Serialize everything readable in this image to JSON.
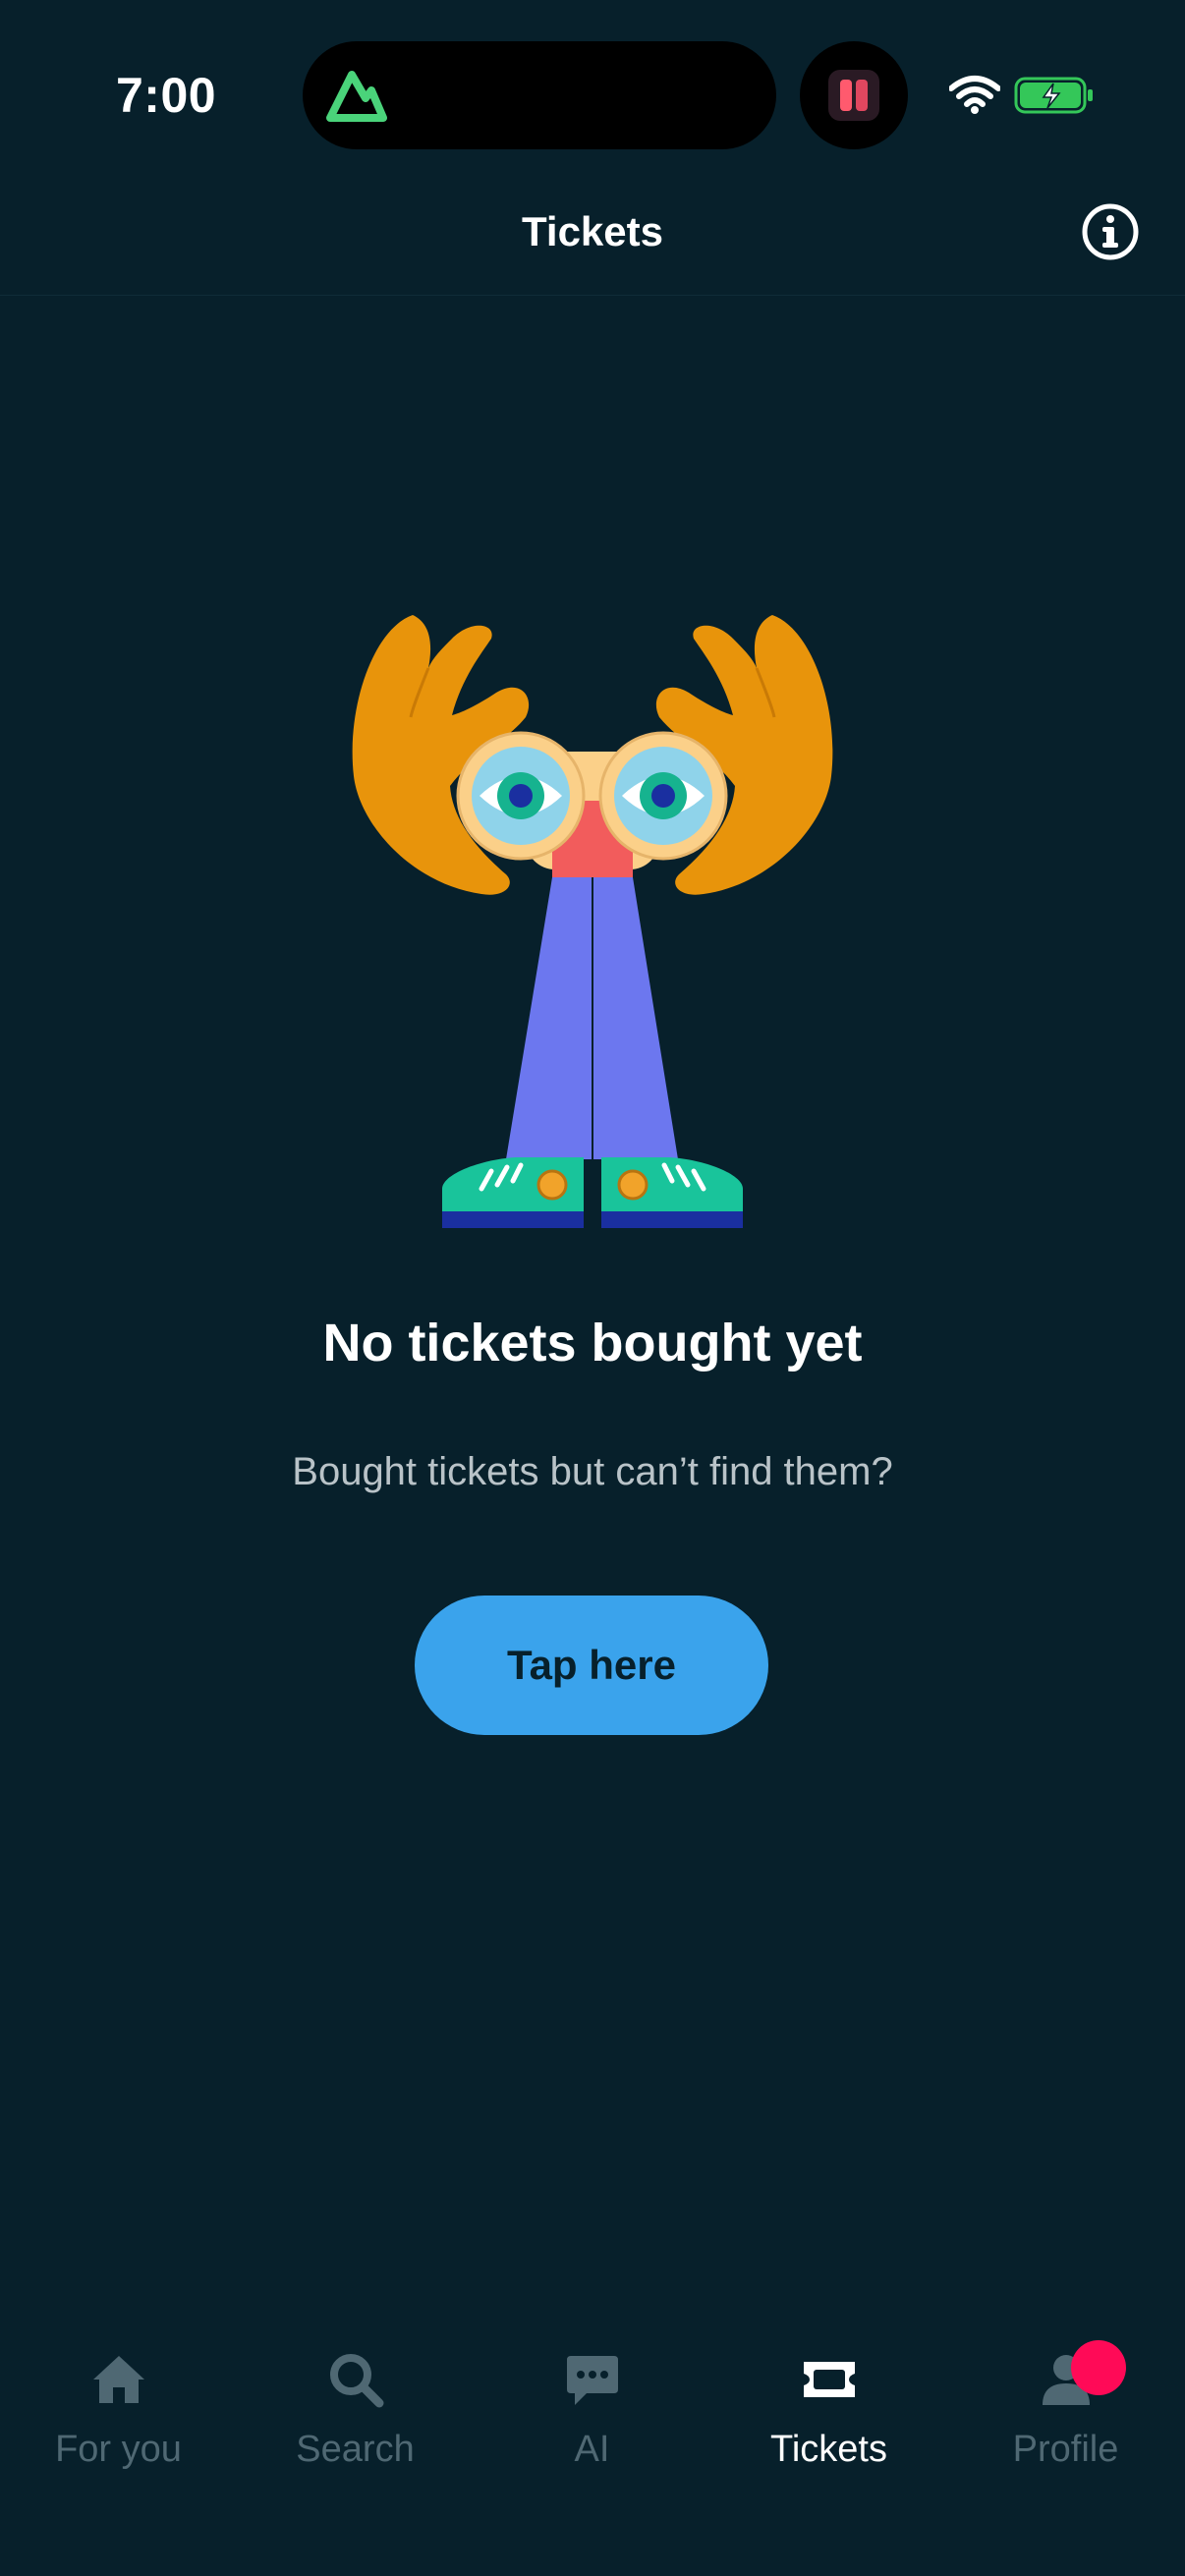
{
  "status_bar": {
    "time": "7:00"
  },
  "header": {
    "title": "Tickets"
  },
  "empty_state": {
    "title": "No tickets bought yet",
    "subtitle": "Bought tickets but can’t find them?",
    "button_label": "Tap here"
  },
  "tabbar": {
    "active": "Tickets",
    "items": [
      {
        "label": "For you",
        "icon": "home-icon"
      },
      {
        "label": "Search",
        "icon": "search-icon"
      },
      {
        "label": "AI",
        "icon": "chat-bubble-icon"
      },
      {
        "label": "Tickets",
        "icon": "ticket-icon"
      },
      {
        "label": "Profile",
        "icon": "person-icon"
      }
    ]
  },
  "colors": {
    "background": "#07202b",
    "accent": "#3aa3ec",
    "inactive_tab": "#4f6873",
    "badge": "#ff0a57"
  }
}
